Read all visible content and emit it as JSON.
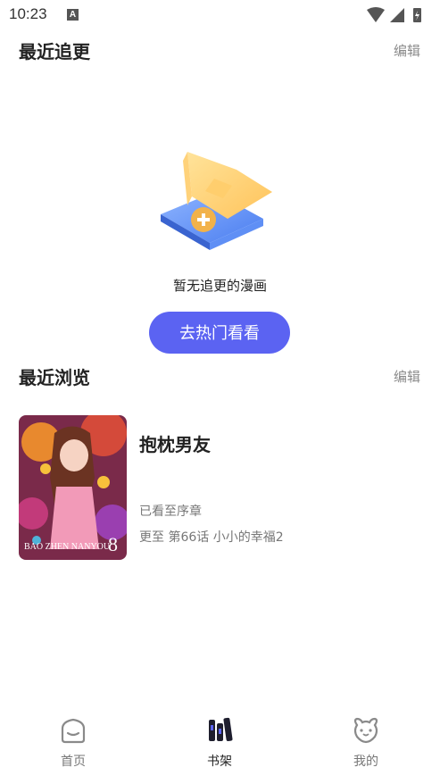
{
  "status_bar": {
    "time": "10:23",
    "notification_icon": "a-icon"
  },
  "recent_updates": {
    "title": "最近追更",
    "edit_label": "编辑",
    "empty_text": "暂无追更的漫画",
    "button_label": "去热门看看"
  },
  "recent_browse": {
    "title": "最近浏览",
    "edit_label": "编辑",
    "items": [
      {
        "title": "抱枕男友",
        "progress": "已看至序章",
        "update": "更至 第66话 小小的幸福2",
        "cover_text": "BAO ZHEN NANYOU",
        "cover_volume": "8"
      }
    ]
  },
  "bottom_nav": {
    "items": [
      {
        "label": "首页",
        "icon": "home-icon"
      },
      {
        "label": "书架",
        "icon": "bookshelf-icon"
      },
      {
        "label": "我的",
        "icon": "profile-icon"
      }
    ]
  },
  "colors": {
    "accent": "#5b63f2",
    "muted": "#8a8a8a"
  }
}
